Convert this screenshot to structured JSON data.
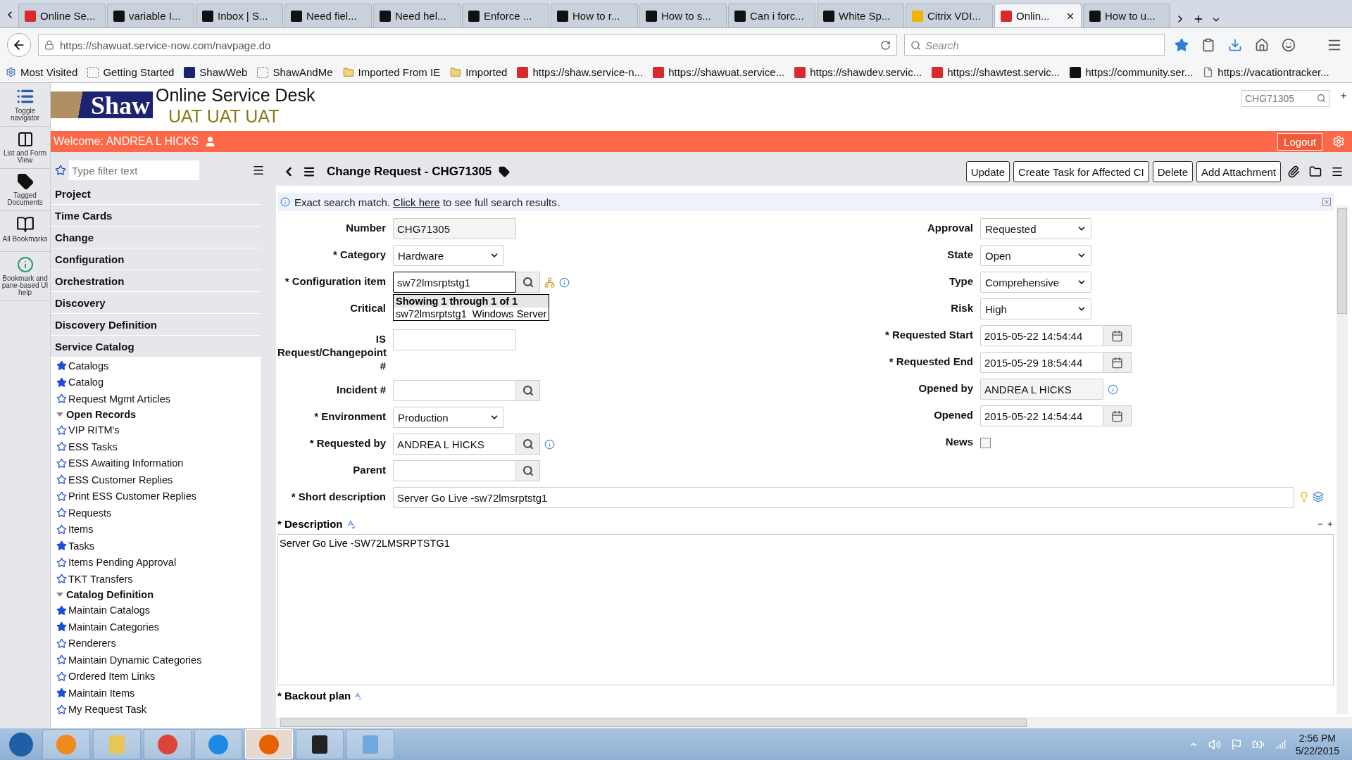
{
  "browser": {
    "tabs": [
      {
        "title": "Online Se...",
        "selected": false
      },
      {
        "title": "variable I...",
        "selected": false
      },
      {
        "title": "Inbox | S...",
        "selected": false
      },
      {
        "title": "Need fiel...",
        "selected": false
      },
      {
        "title": "Need hel...",
        "selected": false
      },
      {
        "title": "Enforce ...",
        "selected": false
      },
      {
        "title": "How to r...",
        "selected": false
      },
      {
        "title": "How to s...",
        "selected": false
      },
      {
        "title": "Can i forc...",
        "selected": false
      },
      {
        "title": "White Sp...",
        "selected": false
      },
      {
        "title": "Citrix VDI...",
        "selected": false
      },
      {
        "title": "Onlin...",
        "selected": true
      },
      {
        "title": "How to u...",
        "selected": false
      }
    ],
    "url": "https://shawuat.service-now.com/navpage.do",
    "search": {
      "placeholder": "Search"
    },
    "bookmarks": [
      "Most Visited",
      "Getting Started",
      "ShawWeb",
      "ShawAndMe",
      "Imported From IE",
      "Imported",
      "https://shaw.service-n...",
      "https://shawuat.service...",
      "https://shawdev.servic...",
      "https://shawtest.servic...",
      "https://community.ser...",
      "https://vacationtracker..."
    ]
  },
  "tools": [
    "Toggle navigator",
    "List and Form View",
    "Tagged Documents",
    "All Bookmarks",
    "Bookmark and pane-based UI help"
  ],
  "header": {
    "logo": "Shaw",
    "title": "Online Service Desk",
    "environment": "UAT UAT UAT",
    "global_search": {
      "placeholder": "CHG71305"
    },
    "welcome": "Welcome: ANDREA L HICKS",
    "logout": "Logout"
  },
  "navigator": {
    "filter": {
      "placeholder": "Type filter text"
    },
    "modules": [
      {
        "label": "Project"
      },
      {
        "label": "Time Cards"
      },
      {
        "label": "Change"
      },
      {
        "label": "Configuration"
      },
      {
        "label": "Orchestration"
      },
      {
        "label": "Discovery"
      },
      {
        "label": "Discovery Definition"
      },
      {
        "label": "Service Catalog",
        "children": [
          {
            "kind": "link",
            "label": "Catalogs",
            "starred": true
          },
          {
            "kind": "link",
            "label": "Catalog",
            "starred": true
          },
          {
            "kind": "link",
            "label": "Request Mgmt Articles",
            "starred": false
          },
          {
            "kind": "group",
            "label": "Open Records",
            "expanded": true,
            "children": [
              {
                "kind": "link",
                "label": "VIP RITM's",
                "starred": false
              },
              {
                "kind": "link",
                "label": "ESS Tasks",
                "starred": false
              },
              {
                "kind": "link",
                "label": "ESS Awaiting Information",
                "starred": false
              },
              {
                "kind": "link",
                "label": "ESS Customer Replies",
                "starred": false
              },
              {
                "kind": "link",
                "label": "Print ESS Customer Replies",
                "starred": false
              },
              {
                "kind": "link",
                "label": "Requests",
                "starred": false
              },
              {
                "kind": "link",
                "label": "Items",
                "starred": false
              },
              {
                "kind": "link",
                "label": "Tasks",
                "starred": true
              },
              {
                "kind": "link",
                "label": "Items Pending Approval",
                "starred": false
              },
              {
                "kind": "link",
                "label": "TKT Transfers",
                "starred": false
              }
            ]
          },
          {
            "kind": "group",
            "label": "Catalog Definition",
            "expanded": true,
            "children": [
              {
                "kind": "link",
                "label": "Maintain Catalogs",
                "starred": true
              },
              {
                "kind": "link",
                "label": "Maintain Categories",
                "starred": true
              },
              {
                "kind": "link",
                "label": "Renderers",
                "starred": false
              },
              {
                "kind": "link",
                "label": "Maintain Dynamic Categories",
                "starred": false
              },
              {
                "kind": "link",
                "label": "Ordered Item Links",
                "starred": false
              },
              {
                "kind": "link",
                "label": "Maintain Items",
                "starred": true
              },
              {
                "kind": "link",
                "label": "My Request Task",
                "starred": false
              }
            ]
          }
        ]
      }
    ]
  },
  "form": {
    "title": "Change Request - CHG71305",
    "buttons": [
      "Update",
      "Create Task for Affected CI",
      "Delete",
      "Add Attachment"
    ],
    "info": {
      "before": "Exact search match.",
      "link": "Click here",
      "after": "to see full search results."
    },
    "left_fields": [
      {
        "label": "Number",
        "required": false,
        "kind": "readonly",
        "value": "CHG71305"
      },
      {
        "label": "Category",
        "required": true,
        "kind": "select",
        "value": "Hardware"
      },
      {
        "label": "Configuration item",
        "required": true,
        "kind": "lookup",
        "value": "sw72lmsrptstg1",
        "focused": true,
        "tree_icon": true,
        "info_icon": true,
        "suggestions": {
          "header": "Showing 1 through 1 of 1",
          "rows": [
            {
              "name": "sw72lmsrptstg1",
              "class": "Windows Server"
            }
          ]
        }
      },
      {
        "label": "Critical",
        "required": false,
        "kind": "none"
      },
      {
        "label": "IS Request/Changepoint #",
        "required": false,
        "kind": "text"
      },
      {
        "label": "Incident #",
        "required": false,
        "kind": "lookup"
      },
      {
        "label": "Environment",
        "required": true,
        "kind": "select",
        "value": "Production"
      },
      {
        "label": "Requested by",
        "required": true,
        "kind": "lookup",
        "value": "ANDREA L HICKS",
        "info_icon": true
      },
      {
        "label": "Parent",
        "required": false,
        "kind": "lookup"
      }
    ],
    "right_fields": [
      {
        "label": "Approval",
        "required": false,
        "kind": "select",
        "value": "Requested"
      },
      {
        "label": "State",
        "required": false,
        "kind": "select",
        "value": "Open"
      },
      {
        "label": "Type",
        "required": false,
        "kind": "select",
        "value": "Comprehensive"
      },
      {
        "label": "Risk",
        "required": false,
        "kind": "select",
        "value": "High"
      },
      {
        "label": "Requested Start",
        "required": true,
        "kind": "date",
        "value": "2015-05-22 14:54:44"
      },
      {
        "label": "Requested End",
        "required": true,
        "kind": "date",
        "value": "2015-05-29 18:54:44"
      },
      {
        "label": "Opened by",
        "required": false,
        "kind": "readonly",
        "value": "ANDREA L HICKS",
        "info_icon": true
      },
      {
        "label": "Opened",
        "required": false,
        "kind": "date",
        "value": "2015-05-22 14:54:44"
      },
      {
        "label": "News",
        "required": false,
        "kind": "checkbox",
        "checked": false
      }
    ],
    "required_mark": "*",
    "short_description": {
      "label": "Short description",
      "required": true,
      "value": "Server Go Live -sw72lmsrptstg1"
    },
    "description": {
      "label": "Description",
      "required": true,
      "value": "Server Go Live -SW72LMSRPTSTG1"
    },
    "backout": {
      "label": "Backout plan",
      "required": true
    }
  },
  "taskbar": {
    "apps": [
      {
        "selected": false
      },
      {
        "selected": false
      },
      {
        "selected": false
      },
      {
        "selected": false
      },
      {
        "selected": true
      },
      {
        "selected": false
      },
      {
        "selected": false
      }
    ],
    "time": "2:56 PM",
    "date": "5/22/2015"
  }
}
